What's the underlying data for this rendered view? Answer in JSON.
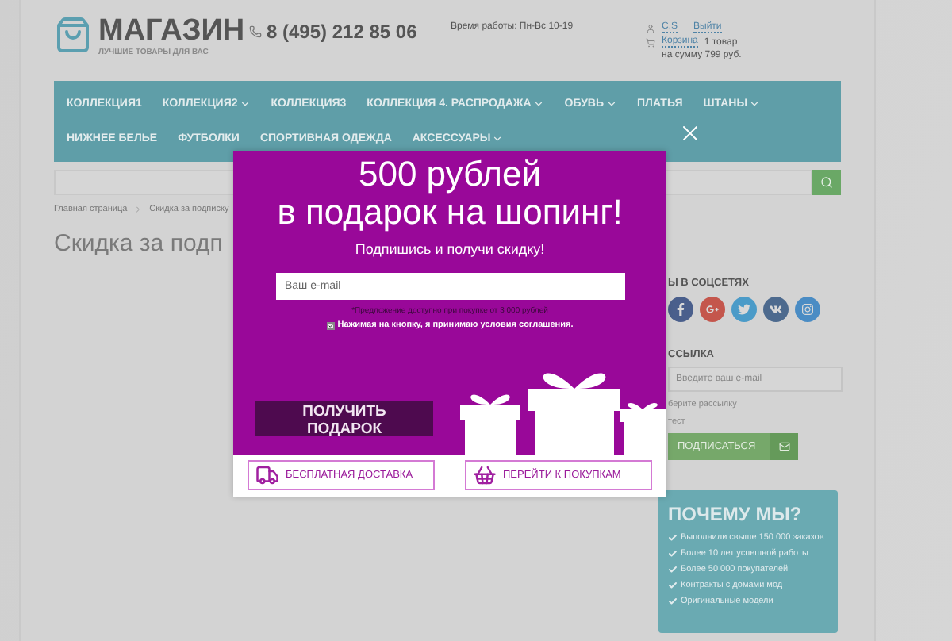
{
  "header": {
    "logo": {
      "name": "МАГАЗИН",
      "tagline": "ЛУЧШИЕ ТОВАРЫ ДЛЯ ВАС"
    },
    "phone": "8 (495) 212 85 06",
    "hours": "Время работы: Пн-Вс 10-19",
    "user": {
      "name": "C.S",
      "logout": "Выйти"
    },
    "cart": {
      "link": "Корзина",
      "count": "1 товар",
      "total": "на сумму 799 руб."
    }
  },
  "nav": {
    "rows": [
      [
        {
          "label": "КОЛЛЕКЦИЯ1",
          "dropdown": false
        },
        {
          "label": "КОЛЛЕКЦИЯ2",
          "dropdown": true
        },
        {
          "label": "КОЛЛЕКЦИЯ3",
          "dropdown": false
        },
        {
          "label": "КОЛЛЕКЦИЯ 4. РАСПРОДАЖА",
          "dropdown": true
        },
        {
          "label": "ОБУВЬ",
          "dropdown": true
        },
        {
          "label": "ПЛАТЬЯ",
          "dropdown": false
        },
        {
          "label": "ШТАНЫ",
          "dropdown": true
        }
      ],
      [
        {
          "label": "НИЖНЕЕ БЕЛЬЕ",
          "dropdown": false
        },
        {
          "label": "ФУТБОЛКИ",
          "dropdown": false
        },
        {
          "label": "СПОРТИВНАЯ ОДЕЖДА",
          "dropdown": false
        },
        {
          "label": "АКСЕССУАРЫ",
          "dropdown": true
        }
      ]
    ]
  },
  "breadcrumb": [
    "Главная страница",
    "Скидка за подписку"
  ],
  "page_title": "Скидка за подп",
  "sidebar": {
    "social_title": "Ы В СОЦСЕТЯХ",
    "social": [
      {
        "kind": "facebook",
        "color": "#4a5f8c"
      },
      {
        "kind": "google",
        "color": "#c4564c"
      },
      {
        "kind": "twitter",
        "color": "#4b9bc8"
      },
      {
        "kind": "vk",
        "color": "#4d6a8e"
      },
      {
        "kind": "instagram",
        "color": "#4a8cc4"
      }
    ],
    "newsletter_title": "ССЫЛКА",
    "newsletter_placeholder": "Введите ваш e-mail",
    "newsletter_hint": "берите рассылку",
    "newsletter_option": "тест",
    "subscribe": "ПОДПИСАТЬСЯ",
    "why": {
      "title": "ПОЧЕМУ МЫ?",
      "items": [
        "Выполнили свыше 150 000 заказов",
        "Более 10 лет успешной работы",
        "Более 50 000 покупателей",
        "Контракты с домами мод",
        "Оригинальные модели"
      ]
    }
  },
  "popup": {
    "title_lines": [
      "500 рублей",
      "в подарок на шопинг!"
    ],
    "subtitle": "Подпишись и получи скидку!",
    "email_placeholder": "Ваш e-mail",
    "note": "*Предложение доступно при покупке от 3 000 рублей",
    "agree": {
      "label": "Нажимая на кнопку, я принимаю условия соглашения.",
      "checked": true
    },
    "button": "ПОЛУЧИТЬ ПОДАРОК",
    "links": [
      {
        "kind": "delivery",
        "label": "БЕСПЛАТНАЯ ДОСТАВКА"
      },
      {
        "kind": "shop",
        "label": "ПЕРЕЙТИ К ПОКУПКАМ"
      }
    ]
  }
}
